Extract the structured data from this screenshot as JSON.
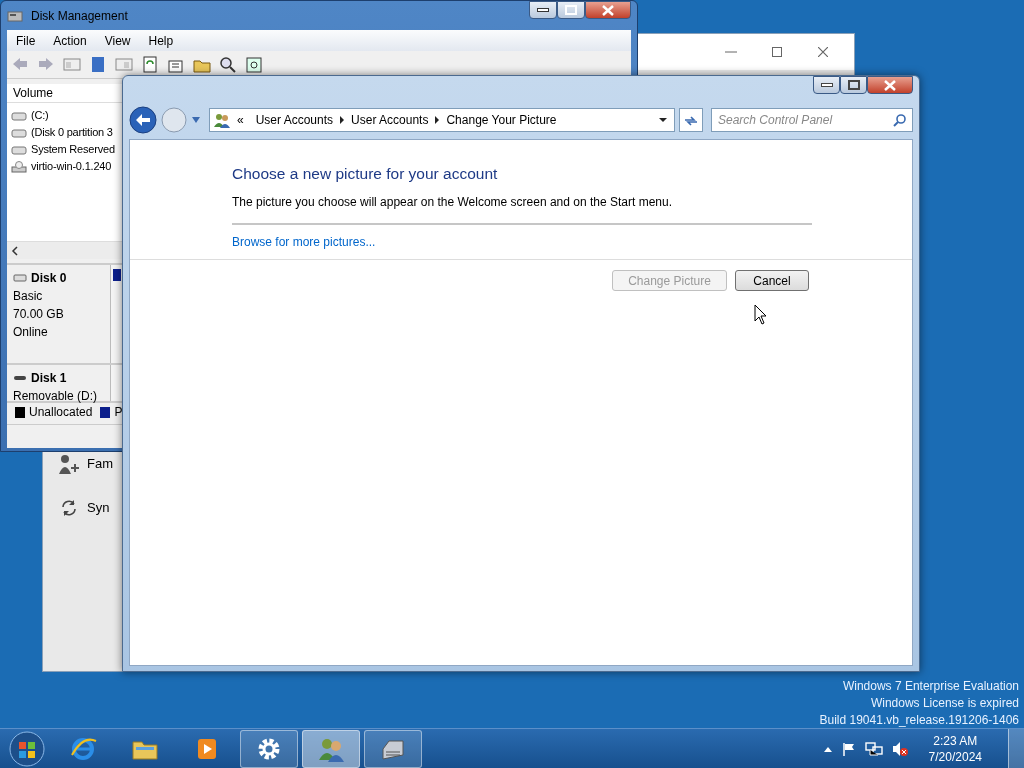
{
  "back_window": {
    "items": [
      {
        "kind": "family",
        "label": "Fam"
      },
      {
        "kind": "sync",
        "label": "Syn"
      }
    ]
  },
  "disk_management": {
    "title": "Disk Management",
    "menu": [
      "File",
      "Action",
      "View",
      "Help"
    ],
    "volume_column": "Volume",
    "volumes": [
      {
        "kind": "disk",
        "name": "(C:)"
      },
      {
        "kind": "disk",
        "name": "(Disk 0 partition 3"
      },
      {
        "kind": "disk",
        "name": "System Reserved"
      },
      {
        "kind": "cd",
        "name": "virtio-win-0.1.240"
      }
    ],
    "disks": [
      {
        "kind": "fixed",
        "name": "Disk 0",
        "lines": [
          "Basic",
          "70.00 GB",
          "Online"
        ]
      },
      {
        "kind": "removable",
        "name": "Disk 1",
        "lines": [
          "Removable (D:)"
        ]
      }
    ],
    "legend": [
      {
        "label": "Unallocated",
        "color": "#000000"
      },
      {
        "label": "P",
        "color": "#0c1f8c"
      }
    ]
  },
  "control_panel": {
    "breadcrumb_prefix": "«",
    "breadcrumb": [
      "User Accounts",
      "User Accounts",
      "Change Your Picture"
    ],
    "search": {
      "placeholder": "Search Control Panel"
    },
    "heading": "Choose a new picture for your account",
    "description": "The picture you choose will appear on the Welcome screen and on the Start menu.",
    "link": "Browse for more pictures...",
    "buttons": [
      {
        "label": "Change Picture",
        "disabled": true
      },
      {
        "label": "Cancel",
        "disabled": false
      }
    ]
  },
  "desktop": {
    "watermark": [
      "Windows 7 Enterprise Evaluation",
      "Windows License is expired",
      "Build 19041.vb_release.191206-1406"
    ]
  },
  "taskbar": {
    "apps": [
      {
        "kind": "ie",
        "running": false,
        "selected": false
      },
      {
        "kind": "explorer",
        "running": false,
        "selected": false
      },
      {
        "kind": "media",
        "running": false,
        "selected": false
      },
      {
        "kind": "settings",
        "running": true,
        "selected": false
      },
      {
        "kind": "users",
        "running": true,
        "selected": true
      },
      {
        "kind": "diskmgmt",
        "running": true,
        "selected": false
      }
    ],
    "clock": {
      "time": "2:23 AM",
      "date": "7/20/2024"
    }
  }
}
